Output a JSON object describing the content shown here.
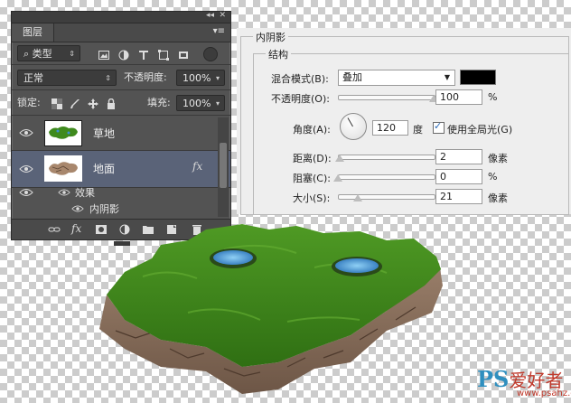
{
  "layers_panel": {
    "tab_title": "图层",
    "filter_label": "类型",
    "blend_mode": "正常",
    "opacity_label": "不透明度:",
    "opacity_value": "100%",
    "lock_label": "锁定:",
    "fill_label": "填充:",
    "fill_value": "100%",
    "layers": [
      {
        "name": "草地",
        "active": false
      },
      {
        "name": "地面",
        "active": true,
        "fx": "fx"
      }
    ],
    "effects_label": "效果",
    "effect_item": "内阴影",
    "bottom_fx": "fx"
  },
  "inner_shadow": {
    "title": "内阴影",
    "group_title": "结构",
    "blend_mode_label": "混合模式(B):",
    "blend_mode_value": "叠加",
    "shadow_color": "#000000",
    "opacity_label": "不透明度(O):",
    "opacity_value": "100",
    "opacity_unit": "%",
    "angle_label": "角度(A):",
    "angle_value": "120",
    "angle_unit": "度",
    "global_light_label": "使用全局光(G)",
    "global_light_checked": true,
    "distance_label": "距离(D):",
    "distance_value": "2",
    "distance_unit": "像素",
    "choke_label": "阻塞(C):",
    "choke_value": "0",
    "choke_unit": "%",
    "size_label": "大小(S):",
    "size_value": "21",
    "size_unit": "像素"
  },
  "watermark": {
    "ps": "PS",
    "site_name": "爱好者",
    "url": "www.psahz.com"
  },
  "colors": {
    "panel_bg": "#535353",
    "active_layer": "#5a6378",
    "grass": "#3f8a1d",
    "soil": "#8a6e5a",
    "water": "#3d8fd0"
  }
}
